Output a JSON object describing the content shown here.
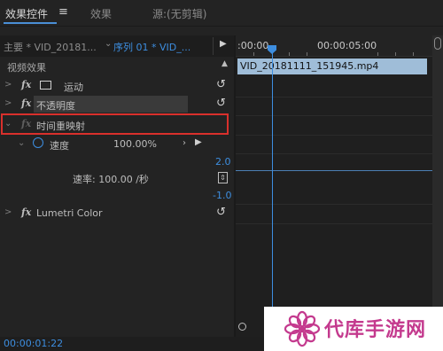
{
  "tabs": [
    {
      "label": "效果控件",
      "active": true
    },
    {
      "label": "效果",
      "active": false
    },
    {
      "label": "源:(无剪辑)",
      "active": false
    }
  ],
  "panel_menu_icon": "hamburger-icon",
  "header": {
    "source_label": "主要 * VID_20181...",
    "sequence_label": "序列 01 * VID_..."
  },
  "section_title": "视频效果",
  "effects": {
    "motion": {
      "label": "运动"
    },
    "opacity": {
      "label": "不透明度"
    },
    "time_remap": {
      "label": "时间重映射"
    },
    "lumetri": {
      "label": "Lumetri Color"
    }
  },
  "speed": {
    "label": "速度",
    "value": "100.00%",
    "graph_max": "2.0",
    "graph_min": "-1.0",
    "rate_text": "速率: 100.00 /秒"
  },
  "timeline": {
    "ruler_start": ":00:00",
    "ruler_mid": "00:00:05:00",
    "clip_name": "VID_20181111_151945.mp4"
  },
  "status": {
    "timecode": "00:00:01:22"
  },
  "watermark": {
    "text": "代库手游网"
  },
  "colors": {
    "accent": "#3d8ee0",
    "highlight": "#d9302c",
    "clip": "#9fbdd8",
    "watermark": "#c43a8e"
  }
}
